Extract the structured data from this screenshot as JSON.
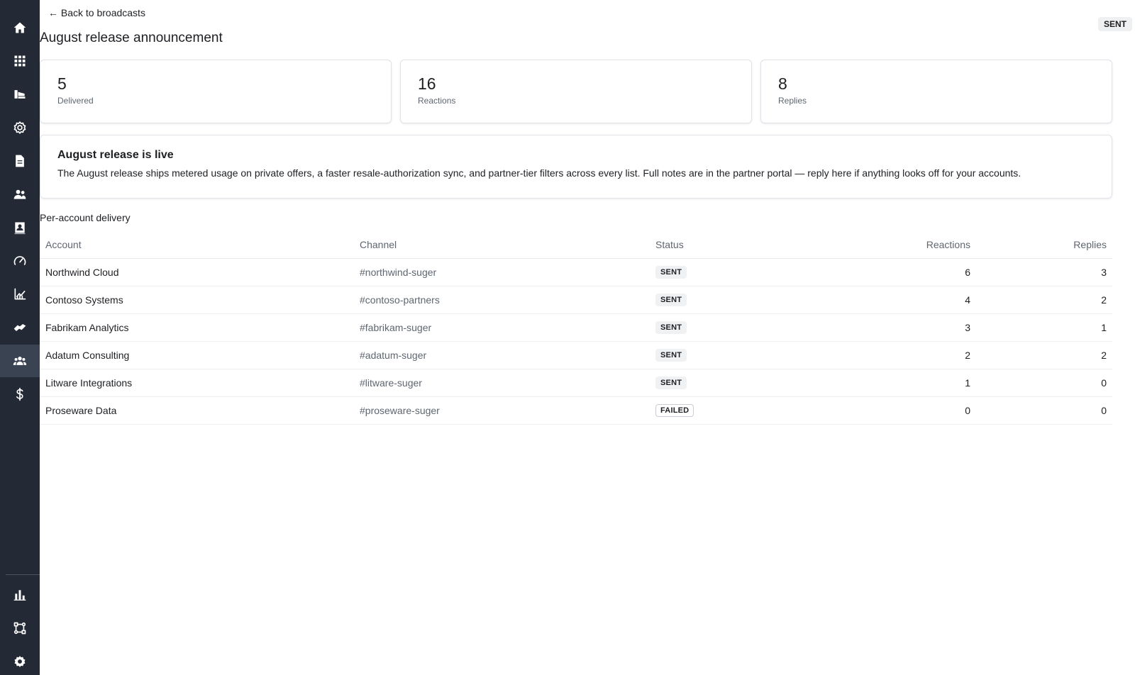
{
  "sidebar": {
    "items": [
      {
        "icon": "home-icon",
        "active": false
      },
      {
        "icon": "apps-grid-icon",
        "active": false
      },
      {
        "icon": "listings-icon",
        "active": false
      },
      {
        "icon": "settings-cog-icon",
        "active": false
      },
      {
        "icon": "document-icon",
        "active": false
      },
      {
        "icon": "people-icon",
        "active": false
      },
      {
        "icon": "contact-card-icon",
        "active": false
      },
      {
        "icon": "speedometer-icon",
        "active": false
      },
      {
        "icon": "chart-trend-icon",
        "active": false
      },
      {
        "icon": "handshake-icon",
        "active": false
      },
      {
        "icon": "group-icon",
        "active": true
      },
      {
        "icon": "dollar-icon",
        "active": false
      }
    ],
    "bottom_items": [
      {
        "icon": "bar-chart-icon"
      },
      {
        "icon": "workflow-icon"
      },
      {
        "icon": "gear-icon"
      }
    ]
  },
  "header": {
    "back_link": "← Back to broadcasts",
    "title": "August release announcement",
    "status_badge": "SENT"
  },
  "stats": [
    {
      "value": "5",
      "label": "Delivered"
    },
    {
      "value": "16",
      "label": "Reactions"
    },
    {
      "value": "8",
      "label": "Replies"
    }
  ],
  "message": {
    "title": "August release is live",
    "body": "The August release ships metered usage on private offers, a faster resale-authorization sync, and partner-tier filters across every list. Full notes are in the partner portal — reply here if anything looks off for your accounts."
  },
  "delivery": {
    "section_label": "Per-account delivery",
    "columns": [
      "Account",
      "Channel",
      "Status",
      "Reactions",
      "Replies"
    ],
    "rows": [
      {
        "account": "Northwind Cloud",
        "channel": "#northwind-suger",
        "status": "SENT",
        "reactions": "6",
        "replies": "3"
      },
      {
        "account": "Contoso Systems",
        "channel": "#contoso-partners",
        "status": "SENT",
        "reactions": "4",
        "replies": "2"
      },
      {
        "account": "Fabrikam Analytics",
        "channel": "#fabrikam-suger",
        "status": "SENT",
        "reactions": "3",
        "replies": "1"
      },
      {
        "account": "Adatum Consulting",
        "channel": "#adatum-suger",
        "status": "SENT",
        "reactions": "2",
        "replies": "2"
      },
      {
        "account": "Litware Integrations",
        "channel": "#litware-suger",
        "status": "SENT",
        "reactions": "1",
        "replies": "0"
      },
      {
        "account": "Proseware Data",
        "channel": "#proseware-suger",
        "status": "FAILED",
        "reactions": "0",
        "replies": "0"
      }
    ]
  }
}
